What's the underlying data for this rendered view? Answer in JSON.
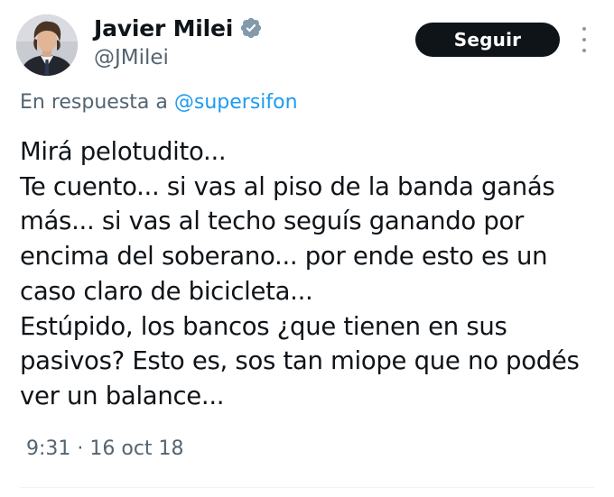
{
  "author": {
    "name": "Javier Milei",
    "handle": "@JMilei",
    "verified": true,
    "avatar_icon": "profile-photo"
  },
  "follow_button": {
    "label": "Seguir"
  },
  "menu": {
    "icon": "more-vertical-icon"
  },
  "reply": {
    "prefix": "En respuesta a ",
    "mention": "@supersifon"
  },
  "tweet": {
    "text": "Mirá pelotudito...\nTe cuento... si vas al piso de la banda ganás más... si vas al techo seguís ganando por encima del soberano... por ende esto es un caso claro de bicicleta...\nEstúpido, los bancos ¿que tienen en sus pasivos? Esto es, sos tan miope que no podés ver un balance...",
    "timestamp": "9:31 · 16 oct 18"
  },
  "colors": {
    "text": "#0f1419",
    "secondary": "#536471",
    "link": "#1d9bf0",
    "button_bg": "#0f1419"
  }
}
